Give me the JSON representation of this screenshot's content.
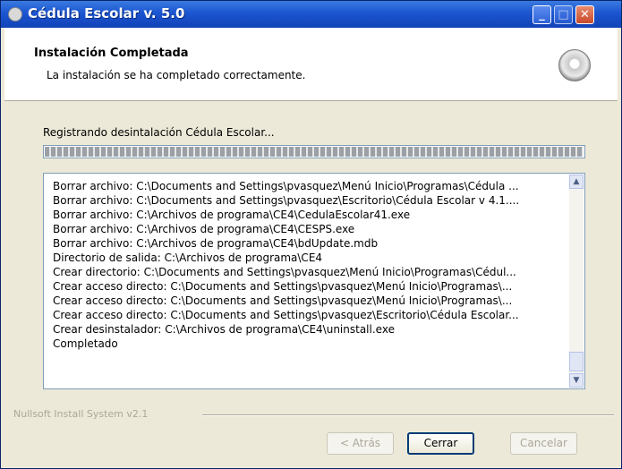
{
  "window": {
    "title": "Cédula Escolar v. 5.0",
    "controls": {
      "minimize": "_",
      "maximize": "□",
      "close": "✕"
    }
  },
  "header": {
    "title": "Instalación Completada",
    "subtitle": "La instalación se ha completado correctamente.",
    "icon": "disc-icon"
  },
  "progress": {
    "status": "Registrando desintalación Cédula Escolar...",
    "percent": 100
  },
  "log": {
    "lines": [
      "Borrar archivo: C:\\Documents and Settings\\pvasquez\\Menú Inicio\\Programas\\Cédula ...",
      "Borrar archivo: C:\\Documents and Settings\\pvasquez\\Escritorio\\Cédula Escolar v 4.1....",
      "Borrar archivo: C:\\Archivos de programa\\CE4\\CedulaEscolar41.exe",
      "Borrar archivo: C:\\Archivos de programa\\CE4\\CESPS.exe",
      "Borrar archivo: C:\\Archivos de programa\\CE4\\bdUpdate.mdb",
      "Directorio de salida: C:\\Archivos de programa\\CE4",
      "Crear directorio: C:\\Documents and Settings\\pvasquez\\Menú Inicio\\Programas\\Cédul...",
      "Crear acceso directo: C:\\Documents and Settings\\pvasquez\\Menú Inicio\\Programas\\...",
      "Crear acceso directo: C:\\Documents and Settings\\pvasquez\\Menú Inicio\\Programas\\...",
      "Crear acceso directo: C:\\Documents and Settings\\pvasquez\\Escritorio\\Cédula Escolar...",
      "Crear desinstalador: C:\\Archivos de programa\\CE4\\uninstall.exe",
      "Completado"
    ]
  },
  "branding": "Nullsoft Install System v2.1",
  "buttons": {
    "back": "< Atrás",
    "close": "Cerrar",
    "cancel": "Cancelar"
  }
}
